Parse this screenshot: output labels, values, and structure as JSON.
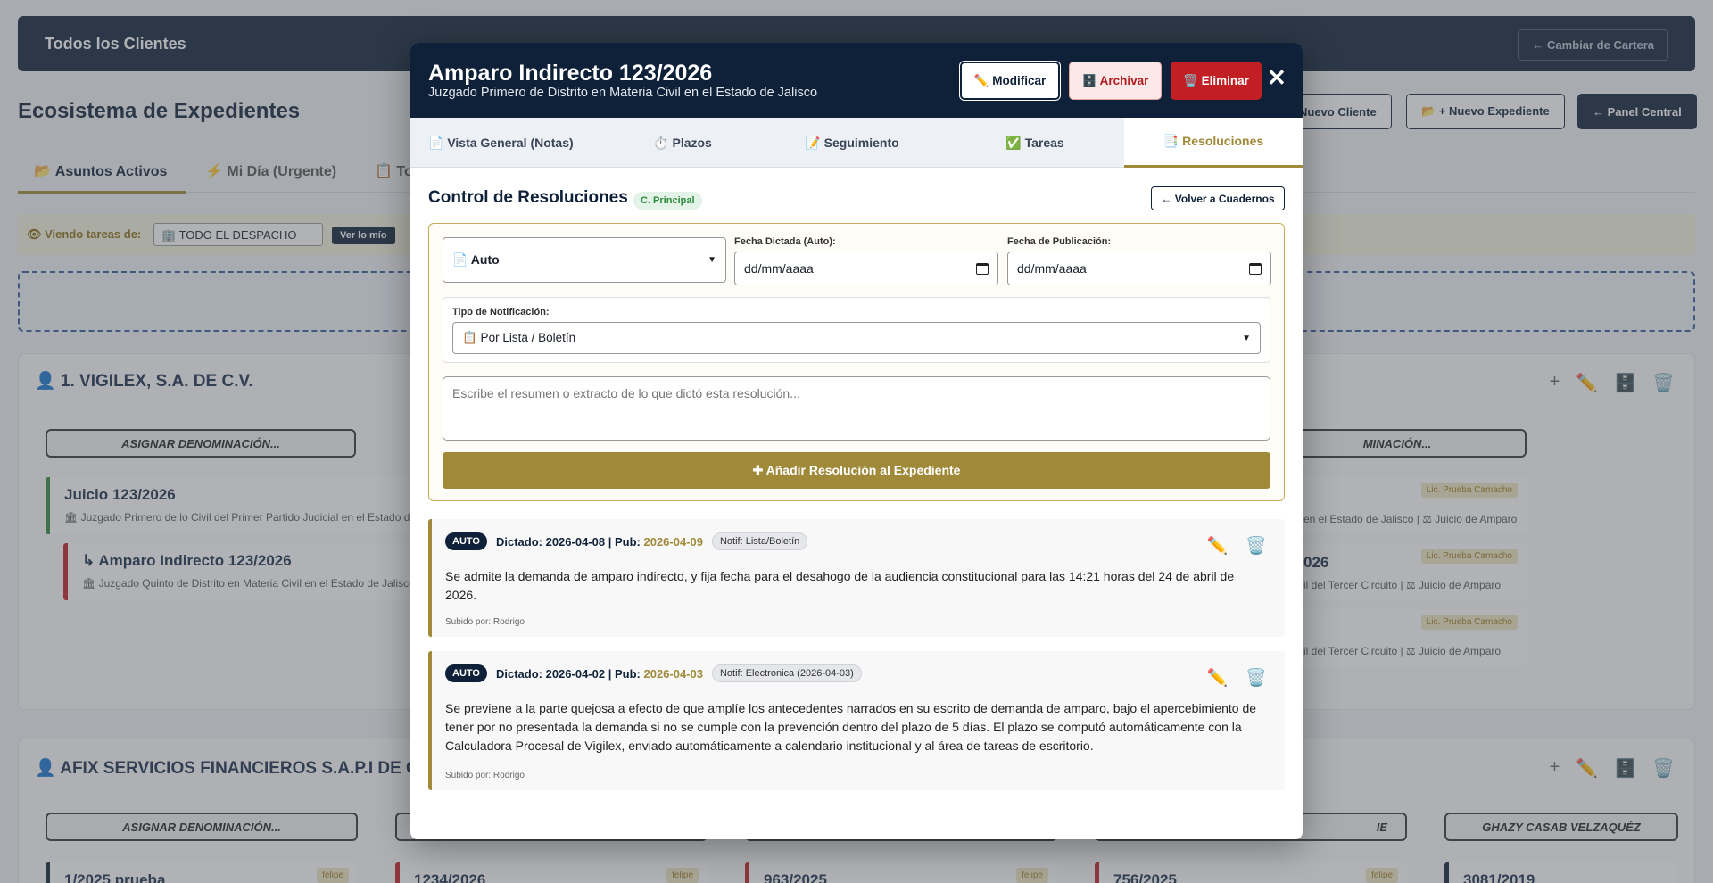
{
  "background": {
    "topbar_title": "Todos los Clientes",
    "change_portfolio": "← Cambiar de Cartera",
    "heading": "Ecosistema de Expedientes",
    "new_client": "Nuevo Cliente",
    "new_file": "📂 + Nuevo Expediente",
    "central_panel": "← Panel Central",
    "tabs": [
      "📂 Asuntos Activos",
      "⚡ Mi Día (Urgente)",
      "📋 To"
    ],
    "filter_label": "👁 Viendo tareas de:",
    "filter_value": "🏢 TODO EL DESPACHO",
    "filter_mine": "Ver lo mío",
    "client1": "👤 1. VIGILEX, S.A. DE C.V.",
    "denom_left": "ASIGNAR DENOMINACIÓN...",
    "denom_right": "MINACIÓN...",
    "case1_title": "Juicio 123/2026",
    "case1_sub": "🏛 Juzgado Primero de lo Civil del Primer Partido Judicial en el Estado de",
    "case2_title": "↳ Amparo Indirecto 123/2026",
    "case2_sub": "🏛 Juzgado Quinto de Distrito en Materia Civil en el Estado de Jalisco |",
    "right_badge": "Lic. Prueba Camacho",
    "right1_sub": "en el Estado de Jalisco | ⚖ Juicio de Amparo",
    "right2_title": "026",
    "right2_sub": "il del Tercer Circuito | ⚖ Juicio de Amparo",
    "right3_sub": "il del Tercer Circuito | ⚖ Juicio de Amparo",
    "client2": "👤 AFIX SERVICIOS FINANCIEROS S.A.P.I DE C.V.;",
    "col_denoms": [
      "ASIGNAR DENOMINACIÓN...",
      "",
      "",
      "IE",
      "GHAZY CASAB VELZAQUÉZ"
    ],
    "col_cases": [
      "1/2025 prueba",
      "1234/2026",
      "963/2025",
      "756/2025",
      "3081/2019"
    ],
    "col_badge": "felipe"
  },
  "modal": {
    "title": "Amparo Indirecto 123/2026",
    "subtitle": "Juzgado Primero de Distrito en Materia Civil en el Estado de Jalisco",
    "btn_modify": "✏️ Modificar",
    "btn_archive": "🗄️ Archivar",
    "btn_delete": "🗑️ Eliminar",
    "close": "✕",
    "tabs": [
      "📄 Vista General (Notas)",
      "⏱️ Plazos",
      "📝 Seguimiento",
      "✅ Tareas",
      "📑 Resoluciones"
    ],
    "section_title": "Control de Resoluciones",
    "section_badge": "C. Principal",
    "back_btn": "← Volver a Cuadernos",
    "form": {
      "type_value": "📄 Auto",
      "dictated_label": "Fecha Dictada (Auto):",
      "dictated_placeholder": "dd/mm/aaaa",
      "pub_label": "Fecha de Publicación:",
      "pub_placeholder": "dd/mm/aaaa",
      "notif_label": "Tipo de Notificación:",
      "notif_value": "📋 Por Lista / Boletín",
      "summary_placeholder": "Escribe el resumen o extracto de lo que dictó esta resolución...",
      "add_button": "✚ Añadir Resolución al Expediente"
    },
    "resolutions": [
      {
        "type": "AUTO",
        "dictated_label": "Dictado:",
        "dictated": "2026-04-08",
        "pub_label": "| Pub:",
        "pub": "2026-04-09",
        "notif": "Notif: Lista/Boletín",
        "text": "Se admite la demanda de amparo indirecto, y fija fecha para el desahogo de la audiencia constitucional para las 14:21 horas del 24 de abril de 2026.",
        "uploaded_by": "Subido por: Rodrigo"
      },
      {
        "type": "AUTO",
        "dictated_label": "Dictado:",
        "dictated": "2026-04-02",
        "pub_label": "| Pub:",
        "pub": "2026-04-03",
        "notif": "Notif: Electronica (2026-04-03)",
        "text": "Se previene a la parte quejosa a efecto de que amplíe los antecedentes narrados en su escrito de demanda de amparo, bajo el apercebimiento de tener por no presentada la demanda si no se cumple con la prevención dentro del plazo de 5 días. El plazo se computó automáticamente con la Calculadora Procesal de Vigilex, enviado automáticamente a calendario institucional y al área de tareas de escritorio.",
        "uploaded_by": "Subido por: Rodrigo"
      }
    ]
  }
}
